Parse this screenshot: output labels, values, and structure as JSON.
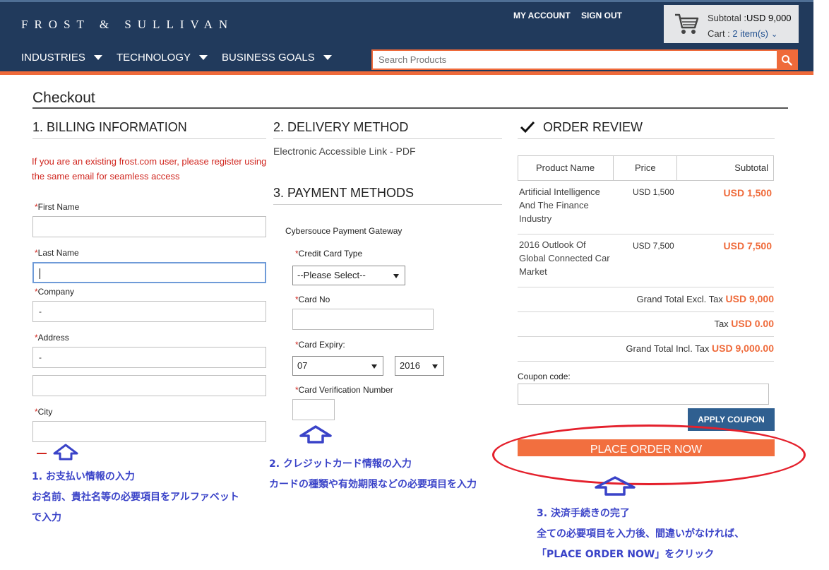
{
  "header": {
    "logo": "FROST & SULLIVAN",
    "my_account": "MY ACCOUNT",
    "sign_out": "SIGN OUT",
    "cart": {
      "subtotal_label": "Subtotal :",
      "subtotal_value": "USD 9,000",
      "cart_label": "Cart :",
      "cart_items": "2 item(s)"
    },
    "nav": [
      "INDUSTRIES",
      "TECHNOLOGY",
      "BUSINESS GOALS"
    ],
    "search_placeholder": "Search Products"
  },
  "page": {
    "title": "Checkout"
  },
  "billing": {
    "title": "1. BILLING INFORMATION",
    "notice": "If you are an existing frost.com user, please register using the same email for seamless access",
    "first_name_label": "First Name",
    "first_name_value": "",
    "last_name_label": "Last Name",
    "last_name_value": "",
    "company_label": "Company",
    "company_value": "-",
    "address_label": "Address",
    "address_value": "-",
    "address2_value": "",
    "city_label": "City",
    "city_value": "",
    "required_mark": "*"
  },
  "delivery": {
    "title": "2. DELIVERY METHOD",
    "method": "Electronic Accessible Link - PDF"
  },
  "payment": {
    "title": "3. PAYMENT METHODS",
    "gateway": "Cybersouce Payment Gateway",
    "card_type_label": "Credit Card Type",
    "card_type_value": "--Please Select--",
    "card_no_label": "Card No",
    "card_no_value": "",
    "card_expiry_label": "Card Expiry:",
    "expiry_month": "07",
    "expiry_year": "2016",
    "cvn_label": "Card Verification Number",
    "cvn_value": ""
  },
  "review": {
    "title": "ORDER REVIEW",
    "col_product": "Product Name",
    "col_price": "Price",
    "col_subtotal": "Subtotal",
    "items": [
      {
        "name": "Artificial Intelligence And The Finance Industry",
        "price": "USD 1,500",
        "subtotal": "USD 1,500"
      },
      {
        "name": "2016 Outlook Of Global Connected Car Market",
        "price": "USD 7,500",
        "subtotal": "USD 7,500"
      }
    ],
    "grand_total_excl_label": "Grand Total Excl. Tax",
    "grand_total_excl_value": "USD 9,000",
    "tax_label": "Tax",
    "tax_value": "USD 0.00",
    "grand_total_incl_label": "Grand Total Incl. Tax",
    "grand_total_incl_value": "USD 9,000.00",
    "coupon_label": "Coupon code:",
    "coupon_value": "",
    "apply_coupon": "APPLY COUPON",
    "place_order": "PLACE ORDER NOW"
  },
  "annotations": {
    "a1_line1": "1. お支払い情報の入力",
    "a1_line2": "お名前、貴社名等の必要項目をアルファベット",
    "a1_line3": "で入力",
    "a2_line1": "2. クレジットカード情報の入力",
    "a2_line2": "カードの種類や有効期限などの必要項目を入力",
    "a3_line1": "3. 決済手続きの完了",
    "a3_line2": "全ての必要項目を入力後、間違いがなければ、",
    "a3_line3": "「PLACE ORDER NOW」をクリック"
  },
  "colors": {
    "header_bg": "#213a5c",
    "accent_orange": "#ef6a3a",
    "required_red": "#d0261f",
    "annotation_blue": "#3a43c8",
    "button_blue": "#2f5f90",
    "ellipse_red": "#e4202c"
  }
}
